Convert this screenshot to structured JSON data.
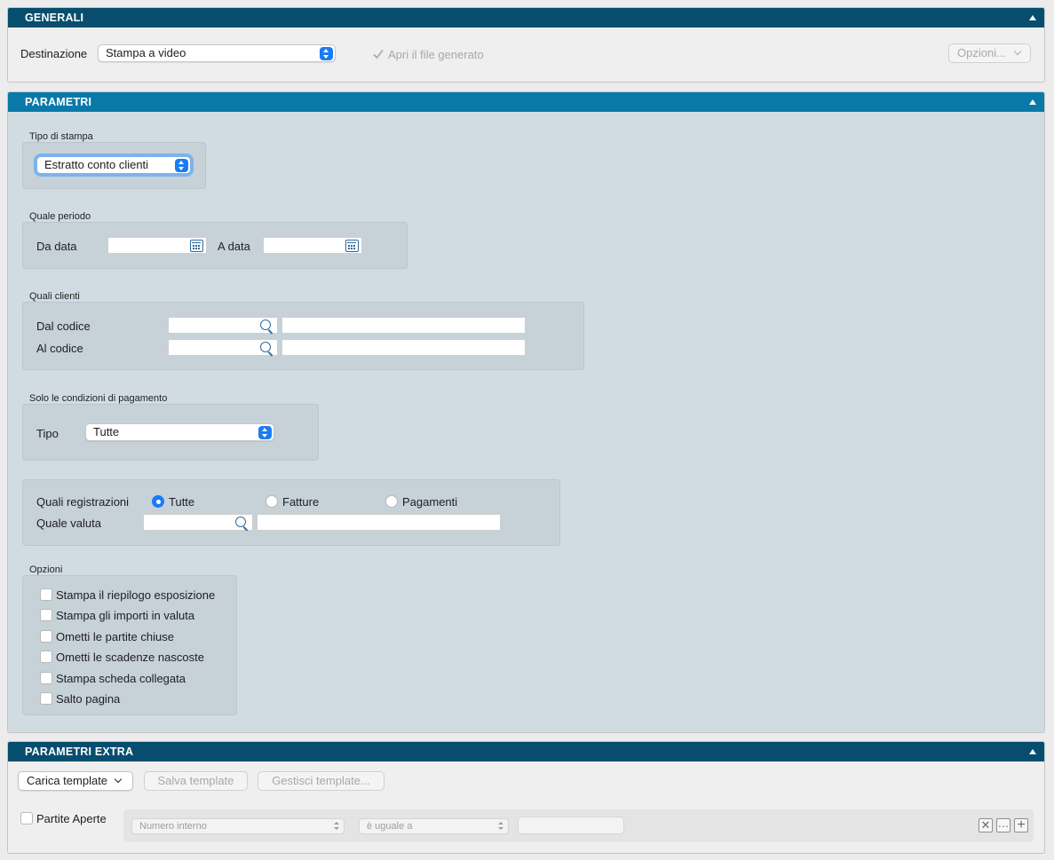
{
  "generali": {
    "title": "GENERALI",
    "destinazione_label": "Destinazione",
    "destinazione_value": "Stampa a video",
    "apri_file_label": "Apri il file generato",
    "opzioni_button": "Opzioni..."
  },
  "parametri": {
    "title": "PARAMETRI",
    "tipo_stampa": {
      "section": "Tipo di stampa",
      "value": "Estratto conto clienti"
    },
    "periodo": {
      "section": "Quale periodo",
      "da_label": "Da data",
      "a_label": "A data"
    },
    "clienti": {
      "section": "Quali clienti",
      "dal_label": "Dal codice",
      "al_label": "Al codice"
    },
    "pagamento": {
      "section": "Solo le condizioni di pagamento",
      "tipo_label": "Tipo",
      "tipo_value": "Tutte"
    },
    "registrazioni": {
      "label": "Quali registrazioni",
      "options": [
        "Tutte",
        "Fatture",
        "Pagamenti"
      ],
      "selected": "Tutte",
      "valuta_label": "Quale valuta"
    },
    "opzioni": {
      "section": "Opzioni",
      "items": [
        "Stampa il riepilogo esposizione",
        "Stampa gli importi in valuta",
        "Ometti le partite chiuse",
        "Ometti le scadenze nascoste",
        "Stampa scheda collegata",
        "Salto pagina"
      ]
    }
  },
  "extra": {
    "title": "PARAMETRI EXTRA",
    "carica_button": "Carica template",
    "salva_button": "Salva template",
    "gestisci_button": "Gestisci template...",
    "partite_label": "Partite Aperte",
    "filter_field": "Numero interno",
    "filter_operator": "è uguale a",
    "mini_buttons": [
      "✕",
      "…",
      "+"
    ]
  },
  "colors": {
    "header_dark": "#074e6e",
    "header_blue": "#0979a7",
    "accent": "#1a7cf4",
    "panel_blue": "#d0dce2"
  }
}
